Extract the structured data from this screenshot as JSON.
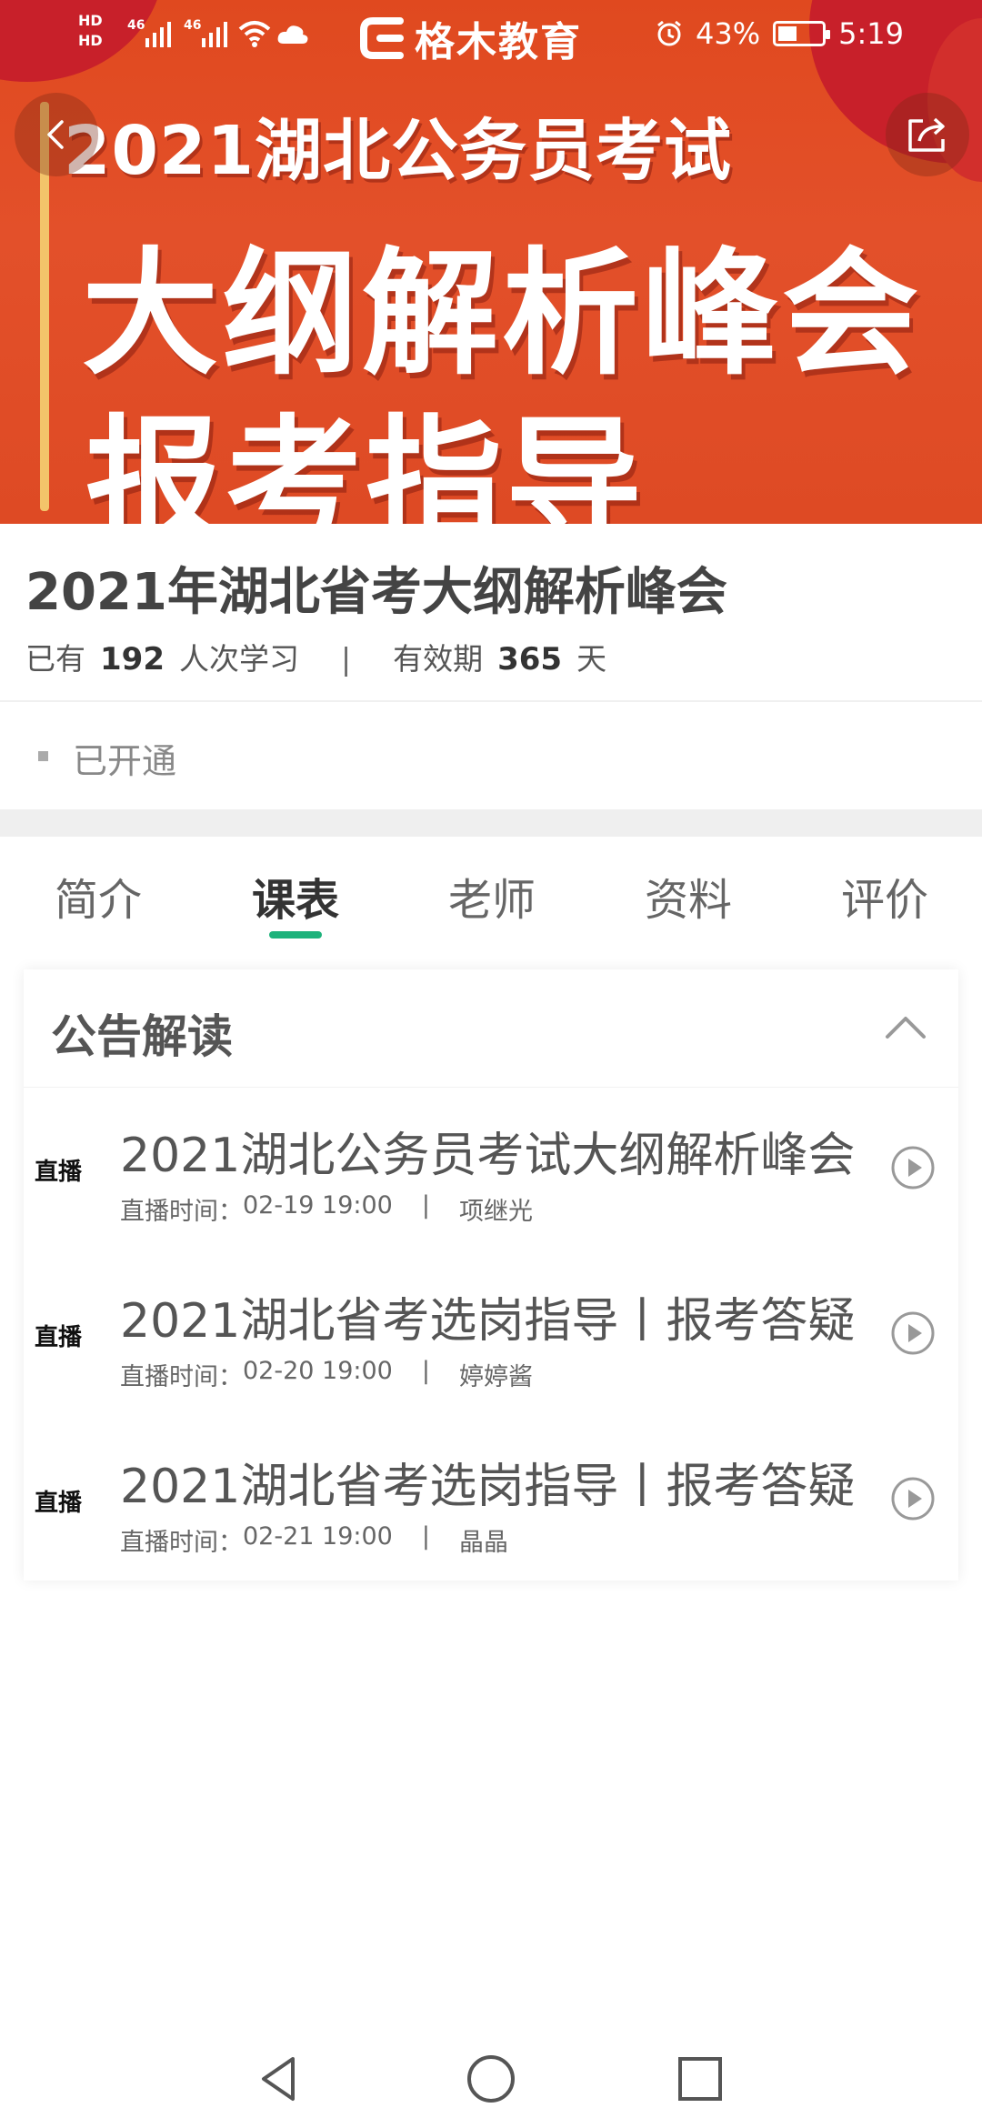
{
  "status_bar": {
    "hd_top": "HD",
    "hd_bottom": "HD",
    "network1": "46",
    "network2": "46",
    "brand": "格木教育",
    "battery": "43%",
    "time": "5:19",
    "icons": [
      "wifi-icon",
      "cloud-icon",
      "alarm-icon",
      "battery-icon"
    ]
  },
  "banner": {
    "line1": "2021湖北公务员考试",
    "line2": "大纲解析峰会",
    "line3": "报考指导",
    "colors": {
      "background": "#e0491f",
      "accent_bar": "#f3c46a",
      "corner": "#c8202a"
    }
  },
  "course": {
    "title": "2021年湖北省考大纲解析峰会",
    "learners_prefix": "已有",
    "learners_count": "192",
    "learners_suffix": "人次学习",
    "separator": "|",
    "validity_prefix": "有效期",
    "validity_days": "365",
    "validity_suffix": "天",
    "status": "已开通"
  },
  "tabs": {
    "items": [
      {
        "label": "简介"
      },
      {
        "label": "课表"
      },
      {
        "label": "老师"
      },
      {
        "label": "资料"
      },
      {
        "label": "评价"
      }
    ],
    "active": "课表",
    "accent": "#1db27b"
  },
  "schedule": {
    "section_title": "公告解读",
    "lessons": [
      {
        "tag": "直播",
        "title": "2021湖北公务员考试大纲解析峰会",
        "time_label": "直播时间：",
        "time": "02-19 19:00",
        "separator": "|",
        "teacher": "项继光"
      },
      {
        "tag": "直播",
        "title": "2021湖北省考选岗指导丨报考答疑",
        "time_label": "直播时间：",
        "time": "02-20 19:00",
        "separator": "|",
        "teacher": "婷婷酱"
      },
      {
        "tag": "直播",
        "title": "2021湖北省考选岗指导丨报考答疑",
        "time_label": "直播时间：",
        "time": "02-21 19:00",
        "separator": "|",
        "teacher": "晶晶"
      }
    ]
  },
  "navbar": {
    "icons": [
      "back-triangle-icon",
      "home-circle-icon",
      "recents-square-icon"
    ]
  }
}
